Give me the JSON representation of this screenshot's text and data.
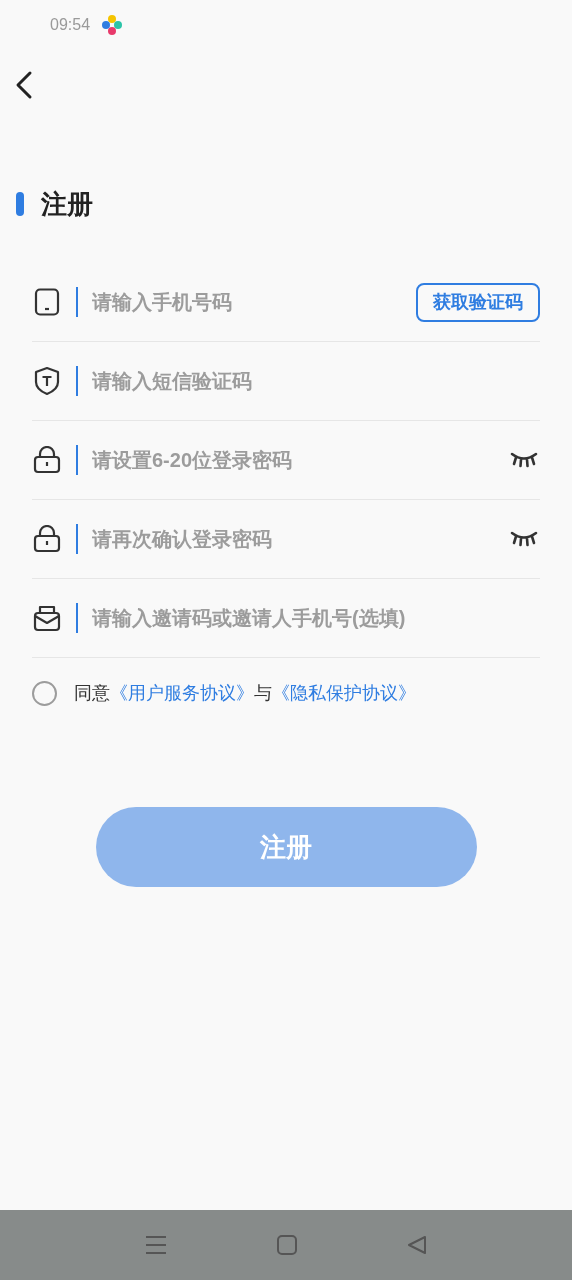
{
  "status_bar": {
    "time": "09:54"
  },
  "title": "注册",
  "fields": [
    {
      "kind": "phone",
      "placeholder": "请输入手机号码",
      "button": "获取验证码"
    },
    {
      "kind": "sms",
      "placeholder": "请输入短信验证码"
    },
    {
      "kind": "password",
      "placeholder": "请设置6-20位登录密码",
      "revealed": false
    },
    {
      "kind": "password",
      "placeholder": "请再次确认登录密码",
      "revealed": false
    },
    {
      "kind": "invite",
      "placeholder": "请输入邀请码或邀请人手机号(选填)"
    }
  ],
  "agreement": {
    "checked": false,
    "parts": [
      {
        "kind": "text",
        "text": "同意"
      },
      {
        "kind": "link",
        "text": "《用户服务协议》"
      },
      {
        "kind": "text",
        "text": "与"
      },
      {
        "kind": "link",
        "text": "《隐私保护协议》"
      }
    ]
  },
  "submit": {
    "label": "注册",
    "disabled": true
  }
}
